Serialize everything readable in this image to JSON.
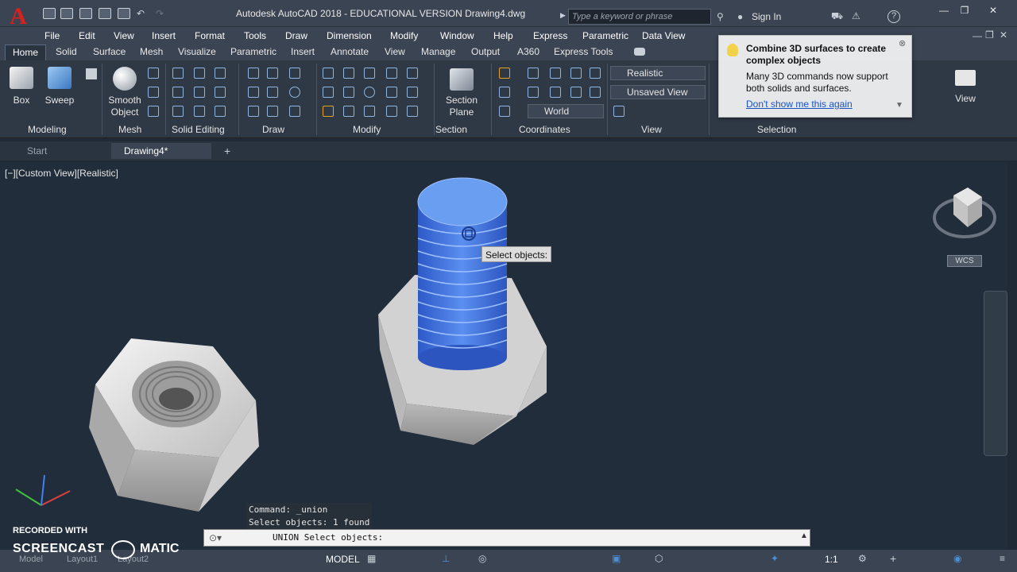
{
  "title_bar": {
    "logo": "A",
    "title": "Autodesk AutoCAD 2018 - EDUCATIONAL VERSION     Drawing4.dwg",
    "search_placeholder": "Type a keyword or phrase",
    "sign_in": "Sign In"
  },
  "menu": [
    "File",
    "Edit",
    "View",
    "Insert",
    "Format",
    "Tools",
    "Draw",
    "Dimension",
    "Modify",
    "Window",
    "Help",
    "Express",
    "Parametric",
    "Data View"
  ],
  "ribbon_tabs": [
    "Home",
    "Solid",
    "Surface",
    "Mesh",
    "Visualize",
    "Parametric",
    "Insert",
    "Annotate",
    "View",
    "Manage",
    "Output",
    "A360",
    "Express Tools"
  ],
  "ribbon": {
    "box": "Box",
    "sweep": "Sweep",
    "smooth_object": "Smooth Object",
    "section_plane": "Section Plane",
    "visual_style": "Realistic",
    "named_view": "Unsaved View",
    "coord_system": "World",
    "view_button": "View",
    "panels": [
      "Modeling",
      "Mesh",
      "Solid Editing",
      "Draw",
      "Modify",
      "Section",
      "Coordinates",
      "View",
      "Selection"
    ]
  },
  "balloon": {
    "heading": "Combine 3D surfaces to create complex objects",
    "body": "Many 3D commands now support both solids and surfaces.",
    "link": "Don't show me this again"
  },
  "file_tabs": {
    "start": "Start",
    "drawing": "Drawing4*"
  },
  "viewport": {
    "label": "[−][Custom View][Realistic]",
    "tooltip": "Select objects:",
    "wcs": "WCS"
  },
  "command": {
    "history": [
      "Command: _union",
      "Select objects: 1 found"
    ],
    "prompt": "UNION Select objects:"
  },
  "status": {
    "model": "MODEL",
    "scale": "1:1"
  },
  "watermark": {
    "line1": "RECORDED WITH",
    "line2": "SCREENCAST",
    "line3": "MATIC"
  },
  "layout_tabs": [
    "Model",
    "Layout1",
    "Layout2"
  ],
  "colors": {
    "accent": "#4a8fdc",
    "selection": "#4a7fe8",
    "logo_red": "#d8211f"
  }
}
